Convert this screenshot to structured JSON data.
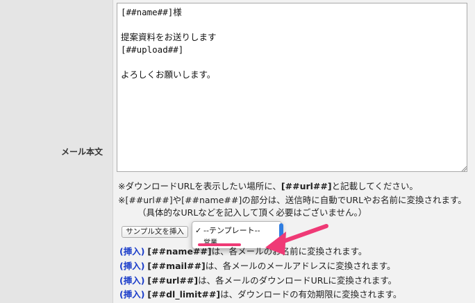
{
  "form": {
    "field_label": "メール本文",
    "body_lines": [
      "[##name##]様",
      "",
      "提案資料をお送りします",
      "[##upload##]",
      "",
      "よろしくお願いします。"
    ],
    "notes": {
      "line1_pre": "※ダウンロードURLを表示したい場所に、",
      "line1_token": "[##url##]",
      "line1_post": "と記載してください。",
      "line2": "※[##url##]や[##name##]の部分は、送信時に自動でURLやお名前に変換されます。",
      "line3": "（具体的なURLなどを記入して頂く必要はございません。）"
    },
    "sample_button_label": "サンプル文を挿入",
    "template_select": {
      "options": [
        {
          "label": "--テンプレート--",
          "checked": true
        },
        {
          "label": "営業",
          "checked": false
        }
      ],
      "check_mark": "✓"
    },
    "insert_lines": [
      {
        "link": "(挿入)",
        "token": "[##name##]",
        "text": "は、各メールのお名前に変換されます。"
      },
      {
        "link": "(挿入)",
        "token": "[##mail##]",
        "text": "は、各メールのメールアドレスに変換されます。"
      },
      {
        "link": "(挿入)",
        "token": "[##url##]",
        "text": "は、各メールのダウンロードURLに変換されます。"
      },
      {
        "link": "(挿入)",
        "token": "[##dl_limit##]",
        "text": "は、ダウンロードの有効期限に変換されます。"
      }
    ]
  },
  "colors": {
    "label_bg": "#e5e5e5",
    "content_bg": "#f2f2f2",
    "insert_link": "#1a3cc9",
    "annotation": "#ef3a76",
    "selection_knob": "#2f7de1"
  }
}
